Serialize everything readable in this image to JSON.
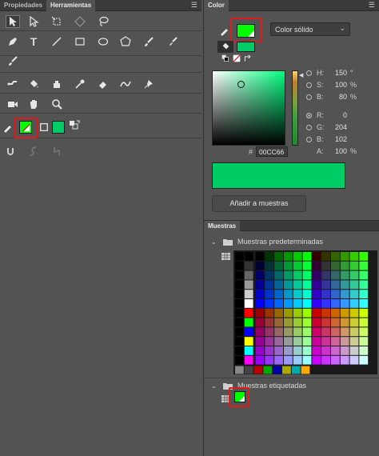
{
  "left_panel": {
    "tabs": [
      "Propiedades",
      "Herramientas"
    ],
    "active_tab": "Herramientas",
    "menu_icon": "panel-menu-icon",
    "tools_row1": [
      "selection-arrow-icon",
      "subselection-arrow-icon",
      "free-transform-icon",
      "gradient-transform-icon",
      "lasso-icon"
    ],
    "tools_row2": [
      "pen-icon",
      "text-icon",
      "line-icon",
      "rectangle-icon",
      "oval-icon",
      "polystar-icon",
      "brush-icon",
      "paint-brush-icon"
    ],
    "tools_row3": [
      "bone-icon",
      "paint-bucket-icon",
      "ink-bottle-icon",
      "eyedropper-icon",
      "eraser-icon",
      "width-tool-icon",
      "pin-icon"
    ],
    "tools_row4": [
      "camera-icon",
      "hand-icon",
      "zoom-icon"
    ],
    "stroke_color": "#00ff00",
    "fill_color": "#00cc66",
    "options_row": [
      "snap-magnet-icon",
      "smooth-icon",
      "straighten-icon"
    ]
  },
  "color_panel": {
    "title": "Color",
    "menu_icon": "panel-menu-icon",
    "fill_type": "Color sólido",
    "stroke_color": "#00ff00",
    "fill_color": "#00cc66",
    "h_label": "H:",
    "h_value": "150",
    "h_unit": "°",
    "s_label": "S:",
    "s_value": "100",
    "s_unit": "%",
    "b_label": "B:",
    "b_value": "80",
    "b_unit": "%",
    "r_label": "R:",
    "r_value": "0",
    "g_label": "G:",
    "g_value": "204",
    "bl_label": "B:",
    "bl_value": "102",
    "a_label": "A:",
    "a_value": "100",
    "a_unit": "%",
    "hex_prefix": "#",
    "hex_value": "00CC66",
    "preview_color": "#00cc66",
    "add_button": "Añadir a muestras"
  },
  "swatches_panel": {
    "title": "Muestras",
    "default_group": "Muestras predeterminadas",
    "tagged_group": "Muestras etiquetadas",
    "tagged_swatch_color": "#00ff00"
  }
}
